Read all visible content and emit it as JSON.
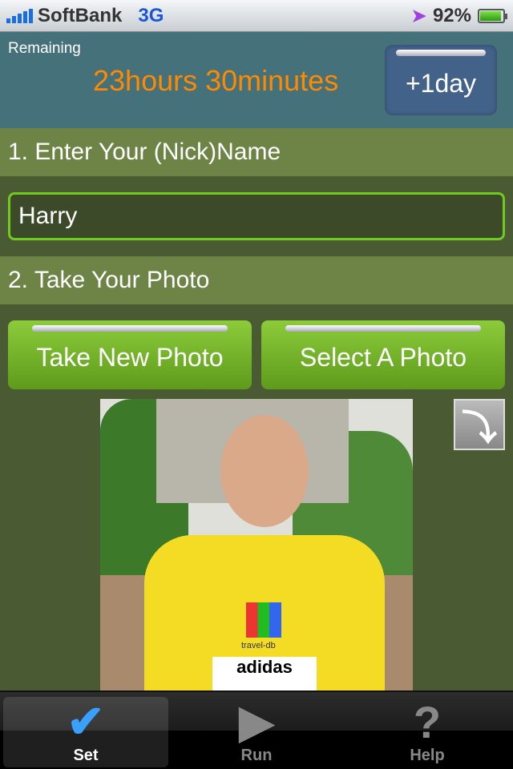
{
  "status_bar": {
    "carrier": "SoftBank",
    "network": "3G",
    "battery": "92%",
    "battery_level": 0.92
  },
  "header": {
    "remaining_label": "Remaining",
    "remaining_value": "23hours 30minutes",
    "add_day_label": "+1day"
  },
  "step1": {
    "title": "1. Enter Your (Nick)Name",
    "name_value": "Harry"
  },
  "step2": {
    "title": "2. Take Your Photo",
    "take_photo_label": "Take New Photo",
    "select_photo_label": "Select A Photo"
  },
  "photo": {
    "shirt_text": "travel-db",
    "bib_text": "adidas"
  },
  "tabbar": {
    "items": [
      {
        "label": "Set",
        "icon": "checkmark-icon",
        "selected": true
      },
      {
        "label": "Run",
        "icon": "play-icon"
      },
      {
        "label": "Help",
        "icon": "question-icon"
      }
    ]
  }
}
